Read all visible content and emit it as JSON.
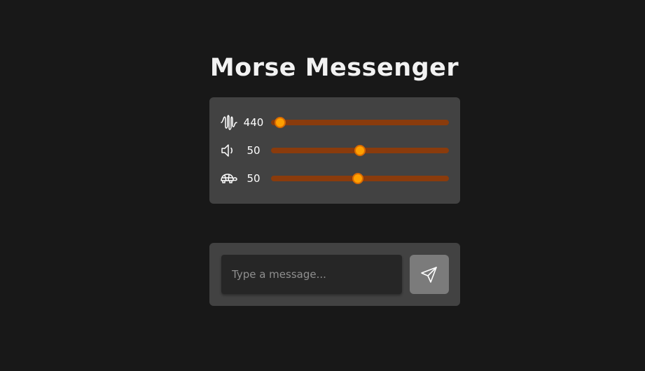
{
  "app": {
    "title": "Morse Messenger"
  },
  "controls": {
    "frequency": {
      "icon": "waveform-icon",
      "value": "440",
      "level": 0.05
    },
    "volume": {
      "icon": "speaker-icon",
      "value": "50",
      "level": 0.5
    },
    "speed": {
      "icon": "turtle-icon",
      "value": "50",
      "level": 0.49
    }
  },
  "composer": {
    "placeholder": "Type a message...",
    "value": "",
    "send_icon": "send-icon"
  },
  "colors": {
    "background": "#181818",
    "panel": "#424242",
    "input": "#262626",
    "slider_track": "#8a3b0c",
    "slider_thumb": "#ffa000",
    "send_button": "#7b7b7b"
  }
}
